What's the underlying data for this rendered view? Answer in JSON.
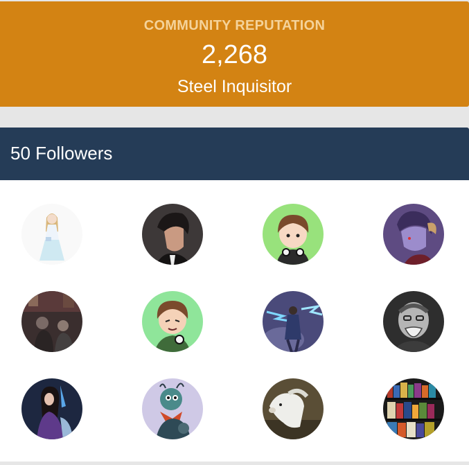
{
  "reputation": {
    "heading": "COMMUNITY REPUTATION",
    "value": "2,268",
    "rank": "Steel Inquisitor",
    "accent_color": "#d38313"
  },
  "followers": {
    "title": "50 Followers",
    "header_color": "#253c57",
    "avatars": [
      {
        "icon": "illustrated-woman-white-dress-avatar"
      },
      {
        "icon": "dark-haired-man-illustration-avatar"
      },
      {
        "icon": "cartoon-boy-headphones-avatar"
      },
      {
        "icon": "purple-demon-horns-avatar"
      },
      {
        "icon": "dark-figures-scene-avatar"
      },
      {
        "icon": "cartoon-boy-green-avatar"
      },
      {
        "icon": "mage-blue-lightning-avatar"
      },
      {
        "icon": "grayscale-laughing-man-avatar"
      },
      {
        "icon": "fantasy-woman-purple-avatar"
      },
      {
        "icon": "cartoon-creature-lavender-avatar"
      },
      {
        "icon": "white-horse-avatar"
      },
      {
        "icon": "bookshelf-games-avatar"
      }
    ]
  }
}
